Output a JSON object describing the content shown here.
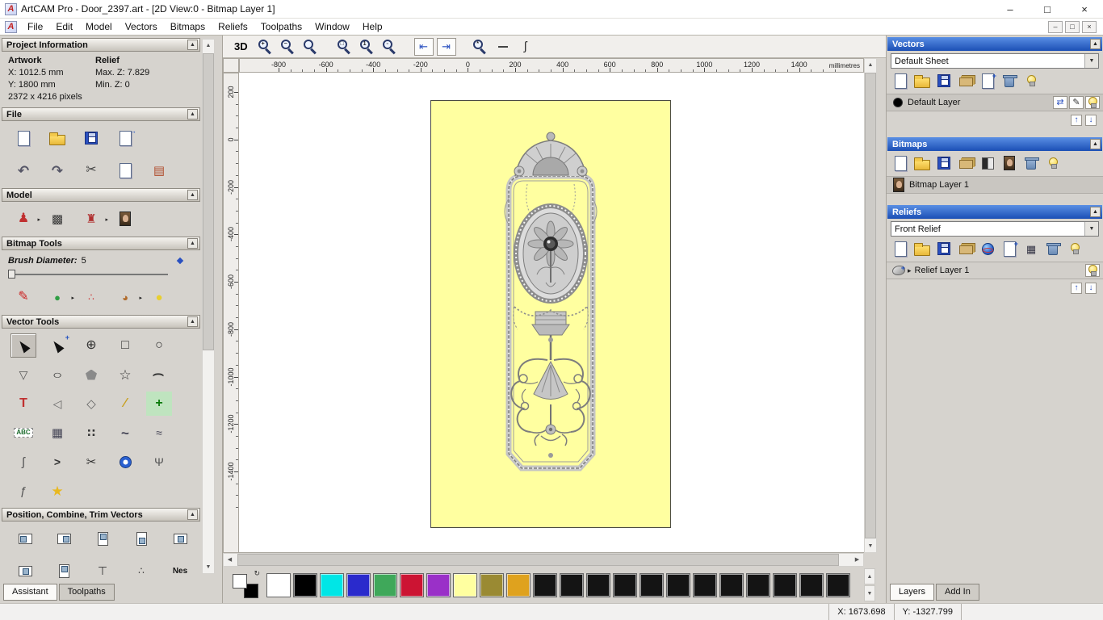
{
  "colors": {
    "canvas_yellow": "#FFFFA0",
    "panel_bg": "#D6D3CE",
    "header_blue": "#1B4FB5",
    "selection_gray": "#C9C6C1"
  },
  "glyphs": {
    "collapse": "▲",
    "combo_down": "▼",
    "scroll_up": "▲",
    "scroll_down": "▼",
    "scroll_left": "◀",
    "scroll_right": "▶",
    "layer_up": "↑",
    "layer_down": "↓",
    "expander": "▸",
    "swap": "↻",
    "minimize": "–",
    "maximize": "□",
    "close": "×"
  },
  "title_bar": {
    "title": "ArtCAM Pro - Door_2397.art - [2D View:0 - Bitmap Layer 1]"
  },
  "menu_bar": {
    "items": [
      "File",
      "Edit",
      "Model",
      "Vectors",
      "Bitmaps",
      "Reliefs",
      "Toolpaths",
      "Window",
      "Help"
    ]
  },
  "left_panel": {
    "project_information": {
      "header": "Project Information",
      "artwork_label": "Artwork",
      "relief_label": "Relief",
      "artwork_x": "X: 1012.5 mm",
      "artwork_y": "Y: 1800 mm",
      "artwork_pixels": "2372 x 4216 pixels",
      "relief_max_z": "Max. Z: 7.829",
      "relief_min_z": "Min. Z: 0"
    },
    "file_header": "File",
    "model_header": "Model",
    "bitmap_tools_header": "Bitmap Tools",
    "brush_diameter_label": "Brush Diameter:",
    "brush_diameter_value": "5",
    "vector_tools_header": "Vector Tools",
    "position_header": "Position, Combine, Trim Vectors",
    "tabs": [
      {
        "label": "Assistant",
        "active": true
      },
      {
        "label": "Toolpaths",
        "active": false
      }
    ]
  },
  "toolbar": {
    "view_3d": "3D"
  },
  "canvas": {
    "ruler_unit": "millimetres",
    "h_labels": [
      "-800",
      "-600",
      "-400",
      "-200",
      "0",
      "200",
      "400",
      "600",
      "800",
      "1000",
      "1200",
      "1400"
    ],
    "v_labels": [
      "200",
      "0",
      "-200",
      "-400",
      "-600",
      "-800",
      "-1000",
      "-1200",
      "-1400"
    ]
  },
  "right_panel": {
    "vectors": {
      "header": "Vectors",
      "sheet_select": "Default Sheet",
      "layer_name": "Default Layer"
    },
    "bitmaps": {
      "header": "Bitmaps",
      "layer_name": "Bitmap Layer 1"
    },
    "reliefs": {
      "header": "Reliefs",
      "relief_select": "Front Relief",
      "layer_name": "Relief Layer 1"
    },
    "tabs": [
      {
        "label": "Layers",
        "active": true
      },
      {
        "label": "Add In",
        "active": false
      }
    ]
  },
  "status_bar": {
    "x": "X: 1673.698",
    "y": "Y: -1327.799"
  },
  "palette": {
    "swatches": [
      "#FFFFFF",
      "#000000",
      "#00E6E6",
      "#2A2ACC",
      "#3FA85A",
      "#CC1433",
      "#9A30C8",
      "#FFFFA0",
      "#9A8A33",
      "#DFA21E",
      "#141414",
      "#141414",
      "#141414",
      "#141414",
      "#141414",
      "#141414",
      "#141414",
      "#141414",
      "#141414",
      "#141414",
      "#141414",
      "#141414"
    ]
  },
  "icons": {
    "file_row1": [
      {
        "name": "new-model-icon",
        "shape": "page"
      },
      {
        "name": "open-model-icon",
        "shape": "folder"
      },
      {
        "name": "save-model-icon",
        "shape": "disk"
      },
      {
        "name": "export-model-icon",
        "shape": "page",
        "badge": "→"
      }
    ],
    "file_row2": [
      {
        "name": "undo-icon",
        "glyph": "↶",
        "color": "#556",
        "size": 17,
        "bold": true
      },
      {
        "name": "redo-icon",
        "glyph": "↷",
        "color": "#556",
        "size": 17,
        "bold": true
      },
      {
        "name": "cut-icon",
        "glyph": "✂",
        "color": "#444",
        "size": 16
      },
      {
        "name": "paste-icon",
        "shape": "page"
      },
      {
        "name": "transfer-icon",
        "glyph": "▤",
        "color": "#b04a2a",
        "size": 15
      }
    ],
    "model_row": [
      {
        "name": "set-model-size-icon",
        "glyph": "♟",
        "color": "#c03030",
        "size": 16,
        "arrow": true
      },
      {
        "name": "greyscale-preview-icon",
        "glyph": "▩",
        "color": "#333",
        "size": 15
      },
      {
        "name": "relief-stamp-icon",
        "glyph": "♜",
        "color": "#b03030",
        "size": 15,
        "arrow": true
      },
      {
        "name": "load-bitmap-icon",
        "shape": "monalisa"
      }
    ],
    "bitmap_row": [
      {
        "name": "paint-brush-icon",
        "glyph": "✎",
        "color": "#cc2222",
        "size": 16
      },
      {
        "name": "colour-picker-icon",
        "glyph": "●",
        "color": "#2f9e44",
        "size": 13,
        "arrow": true
      },
      {
        "name": "paint-selective-icon",
        "glyph": "∴",
        "color": "#cc3333",
        "size": 12
      },
      {
        "name": "colour-palette-icon",
        "glyph": "◕",
        "color": "#b06a2a",
        "size": 13,
        "arrow": true
      },
      {
        "name": "flood-fill-icon",
        "glyph": "●",
        "color": "#e8cf30",
        "size": 15
      }
    ],
    "vector_grid": [
      {
        "name": "select-vectors-icon",
        "shape": "cursor",
        "pressed": true
      },
      {
        "name": "node-editing-icon",
        "shape": "cursor",
        "badge": "+"
      },
      {
        "name": "transform-vectors-icon",
        "glyph": "⊕",
        "color": "#333",
        "size": 16
      },
      {
        "name": "create-rectangle-icon",
        "glyph": "□",
        "color": "#333",
        "size": 16
      },
      {
        "name": "create-circle-icon",
        "glyph": "○",
        "color": "#333",
        "size": 16
      },
      {
        "name": "create-polyline-icon",
        "glyph": "▽",
        "color": "#555",
        "size": 14
      },
      {
        "name": "create-ellipse-icon",
        "glyph": "○",
        "color": "#333",
        "size": 14,
        "stretch": true
      },
      {
        "name": "create-polygon-icon",
        "shape": "pentagon"
      },
      {
        "name": "create-star-icon",
        "glyph": "☆",
        "color": "#333",
        "size": 17
      },
      {
        "name": "create-arc-icon",
        "glyph": "(",
        "color": "#333",
        "size": 14,
        "rot": true,
        "bold": true
      },
      {
        "name": "create-text-icon",
        "glyph": "T",
        "color": "#c03030",
        "size": 16,
        "bold": true
      },
      {
        "name": "text-on-curve-icon",
        "glyph": "◁",
        "color": "#666",
        "size": 14
      },
      {
        "name": "offset-vectors-icon",
        "glyph": "◇",
        "color": "#666",
        "size": 15
      },
      {
        "name": "measure-icon",
        "glyph": "∕",
        "color": "#c8a020",
        "size": 16,
        "bold": true
      },
      {
        "name": "block-paste-icon",
        "glyph": "+",
        "color": "#0a7a0a",
        "size": 16,
        "bold": true,
        "bg": "#bfe4bf"
      },
      {
        "name": "create-text-block-icon",
        "text": "ABC",
        "boxed": true,
        "color": "#1a6a2a"
      },
      {
        "name": "vector-doctor-icon",
        "glyph": "▦",
        "color": "#445",
        "size": 15
      },
      {
        "name": "array-copy-icon",
        "glyph": "∷",
        "color": "#333",
        "size": 14,
        "bold": true
      },
      {
        "name": "fit-curve-icon",
        "glyph": "~",
        "color": "#445",
        "size": 17,
        "bold": true
      },
      {
        "name": "freehand-curve-icon",
        "glyph": "≈",
        "color": "#445",
        "size": 14
      },
      {
        "name": "fillet-arc-icon",
        "glyph": "ʃ",
        "color": "#555",
        "size": 15
      },
      {
        "name": "extend-vector-icon",
        "glyph": ">",
        "color": "#333",
        "size": 14,
        "bold": true
      },
      {
        "name": "trim-vectors-icon",
        "glyph": "✂",
        "color": "#333",
        "size": 15
      },
      {
        "name": "weld-vectors-icon",
        "shape": "donut"
      },
      {
        "name": "split-vector-icon",
        "glyph": "Ψ",
        "color": "#555",
        "size": 14
      },
      {
        "name": "section-profile-icon",
        "glyph": "ƒ",
        "color": "#555",
        "size": 15
      },
      {
        "name": "magic-sparkle-icon",
        "glyph": "★",
        "color": "#e8b820",
        "size": 17
      }
    ],
    "position_row1": [
      {
        "name": "align-left-icon",
        "shape": "align",
        "variant": "l"
      },
      {
        "name": "align-right-icon",
        "shape": "align",
        "variant": "r"
      },
      {
        "name": "align-top-icon",
        "shape": "align",
        "variant": "t"
      },
      {
        "name": "align-bottom-icon",
        "shape": "align",
        "variant": "b"
      },
      {
        "name": "align-centre-icon",
        "shape": "align",
        "variant": "c"
      }
    ],
    "position_row2": [
      {
        "name": "centre-in-page-icon",
        "shape": "align",
        "variant": "c"
      },
      {
        "name": "align-centre-v-icon",
        "shape": "align",
        "variant": "t"
      },
      {
        "name": "mirror-vectors-icon",
        "glyph": "⊤",
        "color": "#333",
        "size": 14
      },
      {
        "name": "distribute-icon",
        "glyph": "∴",
        "color": "#333",
        "size": 12
      },
      {
        "name": "nesting-icon",
        "text": "Nes",
        "color": "#111"
      }
    ],
    "canvas_toolbar": [
      {
        "name": "zoom-in-icon",
        "shape": "mag",
        "label": "+"
      },
      {
        "name": "zoom-out-icon",
        "shape": "mag",
        "label": "−"
      },
      {
        "name": "zoom-previous-icon",
        "shape": "mag",
        "label": ""
      },
      {
        "name": "toolbar-separator",
        "sep": true
      },
      {
        "name": "zoom-window-icon",
        "shape": "mag",
        "label": "□"
      },
      {
        "name": "zoom-100-icon",
        "shape": "mag",
        "label": "1"
      },
      {
        "name": "zoom-page-icon",
        "shape": "mag",
        "label": "▫"
      },
      {
        "name": "toolbar-separator",
        "sep": true
      },
      {
        "name": "snap-left-icon",
        "glyph": "⇤",
        "color": "#2a50c0",
        "size": 13,
        "bordered": true
      },
      {
        "name": "snap-right-icon",
        "glyph": "⇥",
        "color": "#2a50c0",
        "size": 13,
        "bordered": true
      },
      {
        "name": "toolbar-separator",
        "sep": true
      },
      {
        "name": "zoom-objects-icon",
        "shape": "mag",
        "label": "*"
      },
      {
        "name": "line-width-preview",
        "shape": "hline",
        "inter": false
      },
      {
        "name": "spline-preview-icon",
        "glyph": "ʃ",
        "color": "#333",
        "size": 15,
        "inter": false
      }
    ],
    "vectors_toolbar": [
      {
        "name": "new-vector-layer-icon",
        "shape": "page"
      },
      {
        "name": "open-vector-layer-icon",
        "shape": "folder"
      },
      {
        "name": "save-vector-layers-icon",
        "shape": "disk"
      },
      {
        "name": "import-layers-icon",
        "shape": "stack"
      },
      {
        "name": "new-sheet-icon",
        "shape": "page",
        "badge": "+"
      },
      {
        "name": "delete-vector-layer-icon",
        "shape": "trash"
      },
      {
        "name": "show-all-layers-icon",
        "shape": "bulb"
      }
    ],
    "vectors_layer_controls": [
      {
        "name": "move-to-layer-icon",
        "glyph": "⇄",
        "color": "#2a50c0",
        "size": 11,
        "bordered": true
      },
      {
        "name": "edit-layer-colour-icon",
        "glyph": "✎",
        "color": "#333",
        "size": 11,
        "bordered": true
      },
      {
        "name": "layer-visibility-icon",
        "shape": "bulb",
        "bordered": true
      }
    ],
    "bitmaps_toolbar": [
      {
        "name": "new-bitmap-layer-icon",
        "shape": "page"
      },
      {
        "name": "open-bitmap-layer-icon",
        "shape": "folder"
      },
      {
        "name": "save-bitmap-layer-icon",
        "shape": "disk"
      },
      {
        "name": "import-bitmap-icon",
        "shape": "stack"
      },
      {
        "name": "greyscale-toggle-icon",
        "shape": "contrast"
      },
      {
        "name": "bitmap-preview-icon",
        "shape": "monalisa"
      },
      {
        "name": "delete-bitmap-layer-icon",
        "shape": "trash"
      },
      {
        "name": "show-bitmap-layers-icon",
        "shape": "bulb"
      }
    ],
    "bitmap_layer_left": [
      {
        "name": "bitmap-layer-thumb-icon",
        "shape": "monalisa"
      }
    ],
    "reliefs_toolbar": [
      {
        "name": "new-relief-layer-icon",
        "shape": "page"
      },
      {
        "name": "open-relief-layer-icon",
        "shape": "folder"
      },
      {
        "name": "save-relief-layer-icon",
        "shape": "disk"
      },
      {
        "name": "import-relief-icon",
        "shape": "stack"
      },
      {
        "name": "relief-preview-icon",
        "shape": "sphere"
      },
      {
        "name": "new-relief-icon",
        "shape": "page",
        "badge": "+"
      },
      {
        "name": "relief-grid-icon",
        "glyph": "▦",
        "color": "#334",
        "size": 13
      },
      {
        "name": "delete-relief-layer-icon",
        "shape": "trash"
      },
      {
        "name": "show-relief-layers-icon",
        "shape": "bulb"
      }
    ],
    "relief_layer_left": [
      {
        "name": "relief-layer-thumb-icon",
        "shape": "relief-thumb",
        "badge": "+"
      }
    ],
    "relief_layer_right": [
      {
        "name": "relief-layer-visibility-icon",
        "shape": "bulb",
        "bordered": true
      }
    ]
  }
}
